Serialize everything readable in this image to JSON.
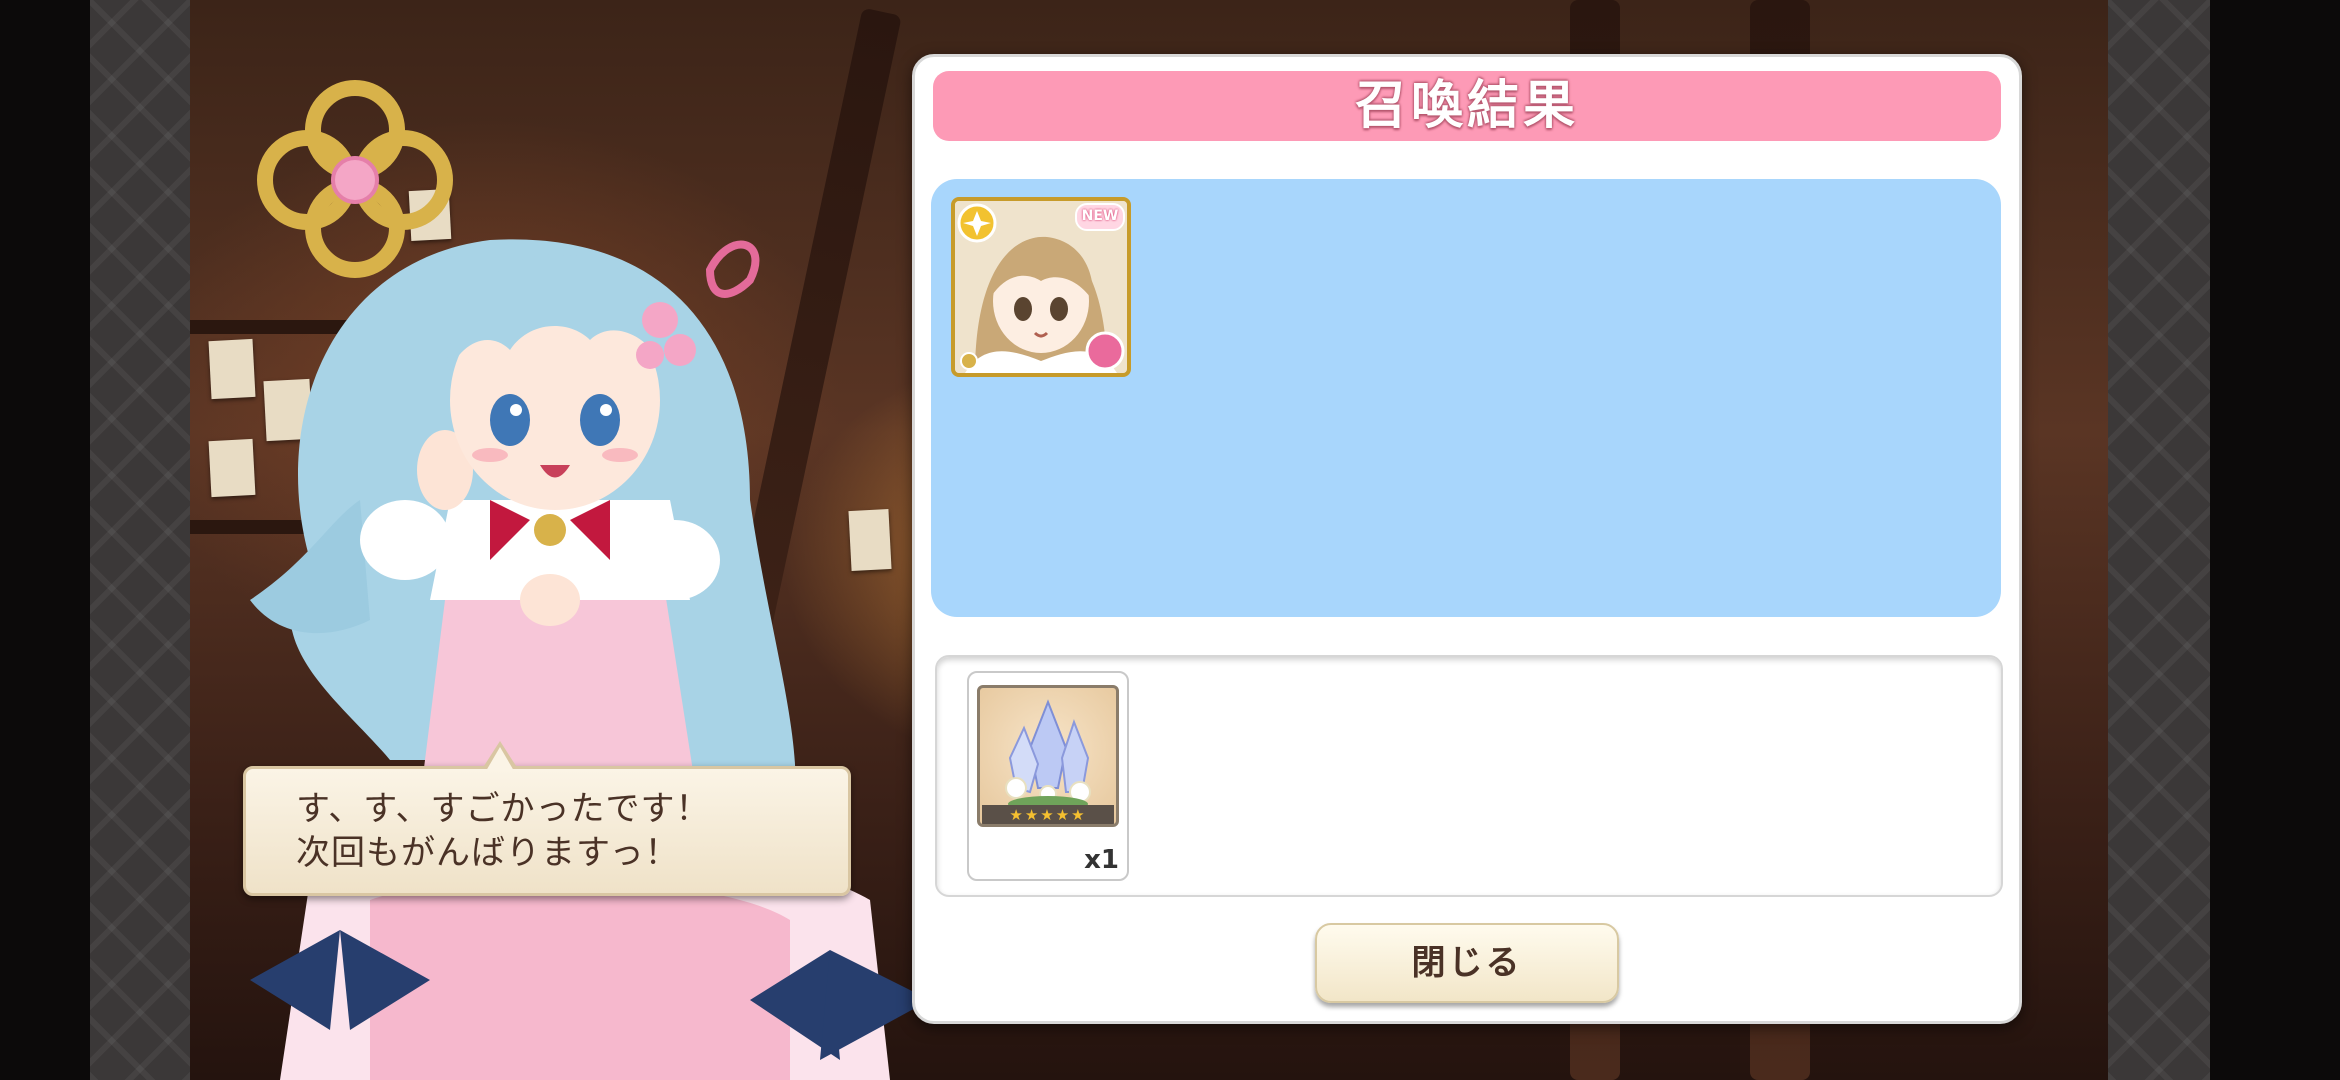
{
  "dialog": {
    "title": "召喚結果",
    "new_badge": "NEW",
    "close_label": "閉じる"
  },
  "speech": {
    "line1": "す、す、すごかったです！",
    "line2": "次回もがんばりますっ！"
  },
  "obtained_item": {
    "quantity": "x1",
    "stars": 5
  },
  "colors": {
    "title_bar": "#fd9ab6",
    "character_area": "#a8d6fc",
    "button": "#f7eedb"
  }
}
